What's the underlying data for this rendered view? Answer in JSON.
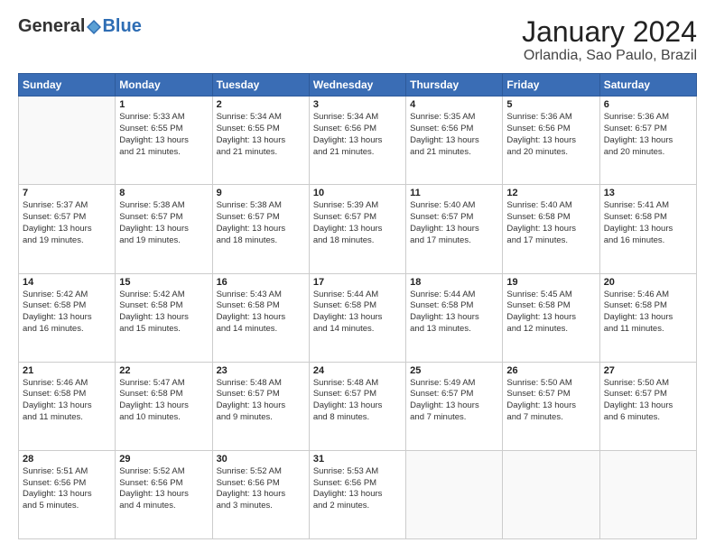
{
  "logo": {
    "general": "General",
    "blue": "Blue"
  },
  "title": "January 2024",
  "subtitle": "Orlandia, Sao Paulo, Brazil",
  "weekdays": [
    "Sunday",
    "Monday",
    "Tuesday",
    "Wednesday",
    "Thursday",
    "Friday",
    "Saturday"
  ],
  "weeks": [
    [
      {
        "day": "",
        "info": ""
      },
      {
        "day": "1",
        "info": "Sunrise: 5:33 AM\nSunset: 6:55 PM\nDaylight: 13 hours\nand 21 minutes."
      },
      {
        "day": "2",
        "info": "Sunrise: 5:34 AM\nSunset: 6:55 PM\nDaylight: 13 hours\nand 21 minutes."
      },
      {
        "day": "3",
        "info": "Sunrise: 5:34 AM\nSunset: 6:56 PM\nDaylight: 13 hours\nand 21 minutes."
      },
      {
        "day": "4",
        "info": "Sunrise: 5:35 AM\nSunset: 6:56 PM\nDaylight: 13 hours\nand 21 minutes."
      },
      {
        "day": "5",
        "info": "Sunrise: 5:36 AM\nSunset: 6:56 PM\nDaylight: 13 hours\nand 20 minutes."
      },
      {
        "day": "6",
        "info": "Sunrise: 5:36 AM\nSunset: 6:57 PM\nDaylight: 13 hours\nand 20 minutes."
      }
    ],
    [
      {
        "day": "7",
        "info": "Sunrise: 5:37 AM\nSunset: 6:57 PM\nDaylight: 13 hours\nand 19 minutes."
      },
      {
        "day": "8",
        "info": "Sunrise: 5:38 AM\nSunset: 6:57 PM\nDaylight: 13 hours\nand 19 minutes."
      },
      {
        "day": "9",
        "info": "Sunrise: 5:38 AM\nSunset: 6:57 PM\nDaylight: 13 hours\nand 18 minutes."
      },
      {
        "day": "10",
        "info": "Sunrise: 5:39 AM\nSunset: 6:57 PM\nDaylight: 13 hours\nand 18 minutes."
      },
      {
        "day": "11",
        "info": "Sunrise: 5:40 AM\nSunset: 6:57 PM\nDaylight: 13 hours\nand 17 minutes."
      },
      {
        "day": "12",
        "info": "Sunrise: 5:40 AM\nSunset: 6:58 PM\nDaylight: 13 hours\nand 17 minutes."
      },
      {
        "day": "13",
        "info": "Sunrise: 5:41 AM\nSunset: 6:58 PM\nDaylight: 13 hours\nand 16 minutes."
      }
    ],
    [
      {
        "day": "14",
        "info": "Sunrise: 5:42 AM\nSunset: 6:58 PM\nDaylight: 13 hours\nand 16 minutes."
      },
      {
        "day": "15",
        "info": "Sunrise: 5:42 AM\nSunset: 6:58 PM\nDaylight: 13 hours\nand 15 minutes."
      },
      {
        "day": "16",
        "info": "Sunrise: 5:43 AM\nSunset: 6:58 PM\nDaylight: 13 hours\nand 14 minutes."
      },
      {
        "day": "17",
        "info": "Sunrise: 5:44 AM\nSunset: 6:58 PM\nDaylight: 13 hours\nand 14 minutes."
      },
      {
        "day": "18",
        "info": "Sunrise: 5:44 AM\nSunset: 6:58 PM\nDaylight: 13 hours\nand 13 minutes."
      },
      {
        "day": "19",
        "info": "Sunrise: 5:45 AM\nSunset: 6:58 PM\nDaylight: 13 hours\nand 12 minutes."
      },
      {
        "day": "20",
        "info": "Sunrise: 5:46 AM\nSunset: 6:58 PM\nDaylight: 13 hours\nand 11 minutes."
      }
    ],
    [
      {
        "day": "21",
        "info": "Sunrise: 5:46 AM\nSunset: 6:58 PM\nDaylight: 13 hours\nand 11 minutes."
      },
      {
        "day": "22",
        "info": "Sunrise: 5:47 AM\nSunset: 6:58 PM\nDaylight: 13 hours\nand 10 minutes."
      },
      {
        "day": "23",
        "info": "Sunrise: 5:48 AM\nSunset: 6:57 PM\nDaylight: 13 hours\nand 9 minutes."
      },
      {
        "day": "24",
        "info": "Sunrise: 5:48 AM\nSunset: 6:57 PM\nDaylight: 13 hours\nand 8 minutes."
      },
      {
        "day": "25",
        "info": "Sunrise: 5:49 AM\nSunset: 6:57 PM\nDaylight: 13 hours\nand 7 minutes."
      },
      {
        "day": "26",
        "info": "Sunrise: 5:50 AM\nSunset: 6:57 PM\nDaylight: 13 hours\nand 7 minutes."
      },
      {
        "day": "27",
        "info": "Sunrise: 5:50 AM\nSunset: 6:57 PM\nDaylight: 13 hours\nand 6 minutes."
      }
    ],
    [
      {
        "day": "28",
        "info": "Sunrise: 5:51 AM\nSunset: 6:56 PM\nDaylight: 13 hours\nand 5 minutes."
      },
      {
        "day": "29",
        "info": "Sunrise: 5:52 AM\nSunset: 6:56 PM\nDaylight: 13 hours\nand 4 minutes."
      },
      {
        "day": "30",
        "info": "Sunrise: 5:52 AM\nSunset: 6:56 PM\nDaylight: 13 hours\nand 3 minutes."
      },
      {
        "day": "31",
        "info": "Sunrise: 5:53 AM\nSunset: 6:56 PM\nDaylight: 13 hours\nand 2 minutes."
      },
      {
        "day": "",
        "info": ""
      },
      {
        "day": "",
        "info": ""
      },
      {
        "day": "",
        "info": ""
      }
    ]
  ]
}
